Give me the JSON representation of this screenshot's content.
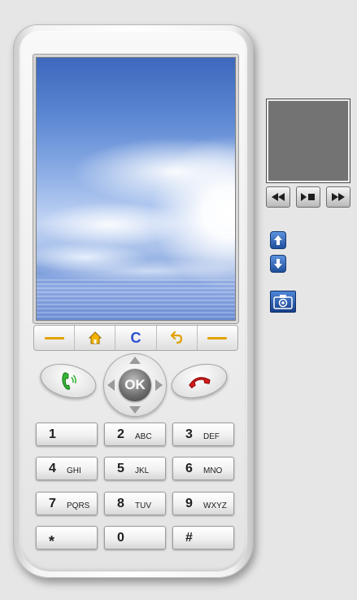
{
  "phone": {
    "softkeys": {
      "left_icon": "dash-icon",
      "home_icon": "home-icon",
      "clear_label": "C",
      "back_icon": "back-arrow-icon",
      "right_icon": "dash-icon"
    },
    "call_icon": "phone-green-icon",
    "end_icon": "phone-red-icon",
    "ok_label": "OK",
    "keypad": [
      {
        "digit": "1",
        "letters": ""
      },
      {
        "digit": "2",
        "letters": "ABC"
      },
      {
        "digit": "3",
        "letters": "DEF"
      },
      {
        "digit": "4",
        "letters": "GHI"
      },
      {
        "digit": "5",
        "letters": "JKL"
      },
      {
        "digit": "6",
        "letters": "MNO"
      },
      {
        "digit": "7",
        "letters": "PQRS"
      },
      {
        "digit": "8",
        "letters": "TUV"
      },
      {
        "digit": "9",
        "letters": "WXYZ"
      },
      {
        "digit": "*",
        "letters": ""
      },
      {
        "digit": "0",
        "letters": ""
      },
      {
        "digit": "#",
        "letters": ""
      }
    ]
  },
  "side_panel": {
    "media_controls": [
      "rewind-icon",
      "play-pause-icon",
      "fast-forward-icon"
    ],
    "scroll_up_icon": "arrow-up-icon",
    "scroll_down_icon": "arrow-down-icon",
    "camera_icon": "camera-icon"
  },
  "colors": {
    "softkey_accent": "#e3a300",
    "clear_key": "#2e4fd0",
    "call_green": "#33aa33",
    "end_red": "#d21a1a",
    "side_button_blue": "#1f4f9c"
  }
}
